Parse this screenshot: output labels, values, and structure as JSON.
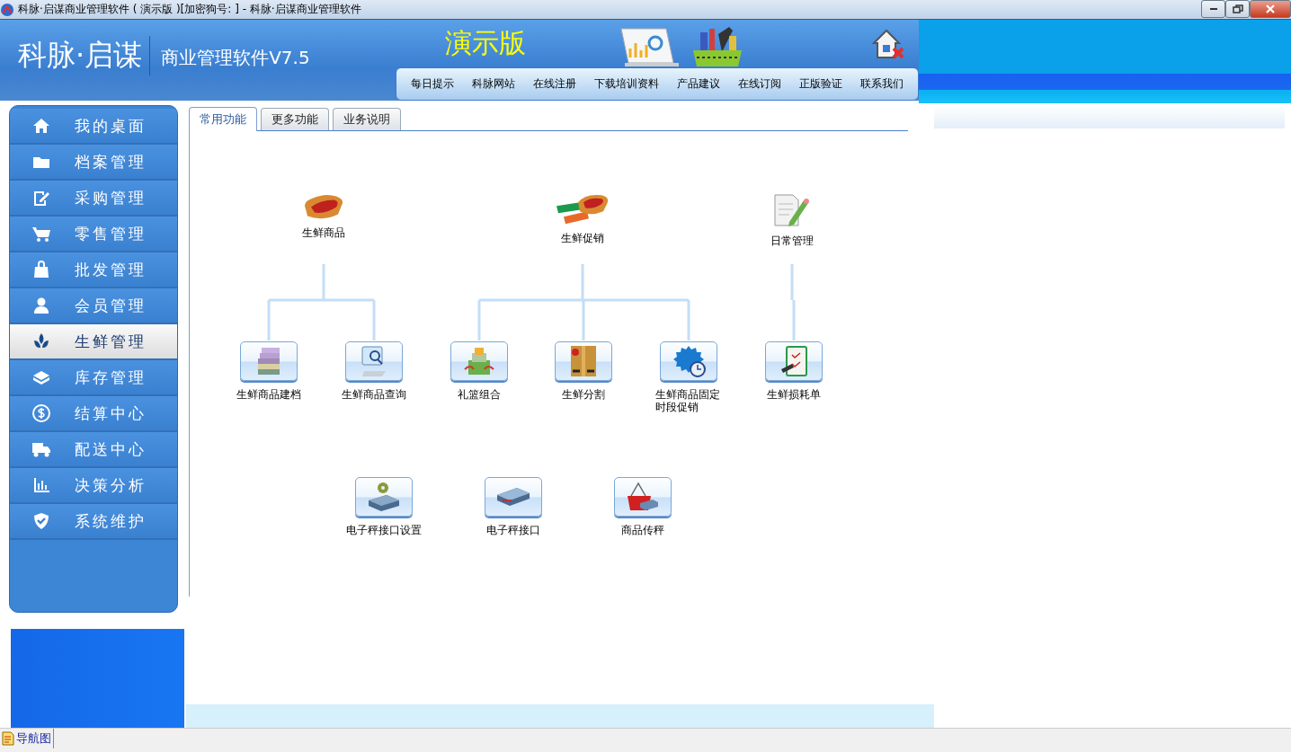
{
  "window": {
    "title": "科脉·启谋商业管理软件 ( 演示版 )[加密狗号: ] - 科脉·启谋商业管理软件"
  },
  "header": {
    "brand": "科脉·启谋",
    "product": "商业管理软件V7.5",
    "edition": "演示版",
    "links": [
      "每日提示",
      "科脉网站",
      "在线注册",
      "下载培训资料",
      "产品建议",
      "在线订阅",
      "正版验证",
      "联系我们"
    ]
  },
  "sidebar": {
    "items": [
      {
        "label": "我的桌面",
        "selected": false
      },
      {
        "label": "档案管理",
        "selected": false
      },
      {
        "label": "采购管理",
        "selected": false
      },
      {
        "label": "零售管理",
        "selected": false
      },
      {
        "label": "批发管理",
        "selected": false
      },
      {
        "label": "会员管理",
        "selected": false
      },
      {
        "label": "生鲜管理",
        "selected": true
      },
      {
        "label": "库存管理",
        "selected": false
      },
      {
        "label": "结算中心",
        "selected": false
      },
      {
        "label": "配送中心",
        "selected": false
      },
      {
        "label": "决策分析",
        "selected": false
      },
      {
        "label": "系统维护",
        "selected": false
      }
    ]
  },
  "tabs": [
    {
      "label": "常用功能",
      "selected": true
    },
    {
      "label": "更多功能",
      "selected": false
    },
    {
      "label": "业务说明",
      "selected": false
    }
  ],
  "diagram": {
    "groups": [
      {
        "label": "生鲜商品",
        "children": [
          {
            "label": "生鲜商品建档"
          },
          {
            "label": "生鲜商品查询"
          }
        ]
      },
      {
        "label": "生鲜促销",
        "children": [
          {
            "label": "礼篮组合"
          },
          {
            "label": "生鲜分割"
          },
          {
            "label": "生鲜商品固定时段促销"
          }
        ]
      },
      {
        "label": "日常管理",
        "children": [
          {
            "label": "生鲜损耗单"
          }
        ]
      }
    ],
    "extra_functions": [
      {
        "label": "电子秤接口设置"
      },
      {
        "label": "电子秤接口"
      },
      {
        "label": "商品传秤"
      }
    ]
  },
  "status_bar": {
    "tabs": [
      "导航图"
    ]
  }
}
